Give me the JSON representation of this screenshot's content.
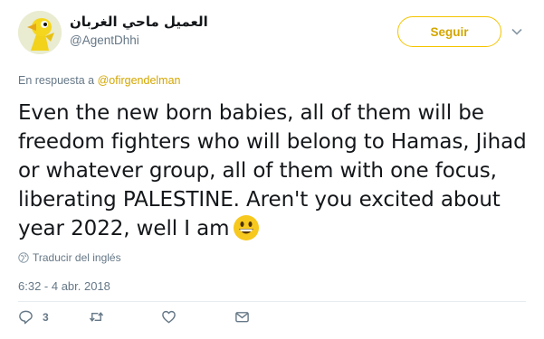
{
  "author": {
    "display_name": "العميل ماحي الغربان",
    "handle": "@AgentDhhi",
    "avatar_icon": "yellow-bird-avatar"
  },
  "follow_label": "Seguir",
  "reply": {
    "prefix": "En respuesta a",
    "mention": "@ofirgendelman"
  },
  "tweet": {
    "text": "Even the new born babies, all of them will be freedom fighters who will belong to Hamas, Jihad or whatever group, all of them with one focus, liberating PALESTINE. Aren't you excited about year 2022, well I am",
    "emoji": "grinning-face-emoji"
  },
  "translate_label": "Traducir del inglés",
  "timestamp": "6:32 - 4 abr. 2018",
  "actions": {
    "reply_count": "3",
    "retweet_count": "",
    "like_count": ""
  },
  "colors": {
    "accent": "#d3a600",
    "follow_border": "#f5c400",
    "secondary_text": "#657786"
  }
}
